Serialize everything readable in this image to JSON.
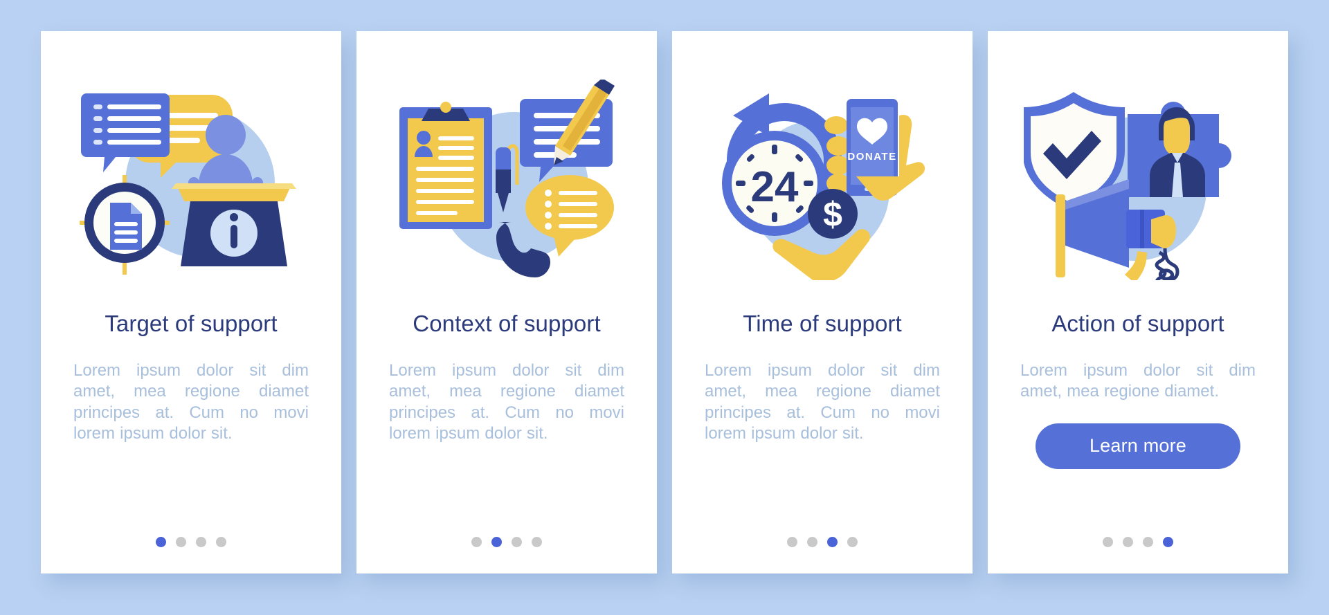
{
  "theme": {
    "background": "#b9d1f2",
    "card_background": "#ffffff",
    "title_color": "#2b3a7a",
    "body_color": "#a8bfdc",
    "accent_blue": "#5570d6",
    "dot_active": "#4a63d8",
    "dot_inactive": "#c9c9c9",
    "accent_yellow": "#f2c94c",
    "accent_navy": "#2b3a7a",
    "blob_blue": "#b6cfef"
  },
  "cards": [
    {
      "illustration_name": "target-of-support-illustration",
      "illustration_icons": [
        "speech-bubble-list-icon",
        "yellow-speech-bubble-icon",
        "crosshair-target-icon",
        "document-icon",
        "speaker-podium-icon",
        "info-circle-icon"
      ],
      "title": "Target of support",
      "body": "Lorem ipsum dolor sit dim amet, mea regione diamet principes at. Cum no movi lorem ipsum dolor sit.",
      "button": null,
      "dots": {
        "count": 4,
        "active_index": 0
      }
    },
    {
      "illustration_name": "context-of-support-illustration",
      "illustration_icons": [
        "clipboard-profile-icon",
        "pen-icon",
        "speech-bubble-lines-icon",
        "pencil-icon",
        "yellow-bullet-bubble-icon",
        "phone-handset-icon"
      ],
      "title": "Context of support",
      "body": "Lorem ipsum dolor sit dim amet, mea regione diamet principes at. Cum no movi lorem ipsum dolor sit.",
      "button": null,
      "dots": {
        "count": 4,
        "active_index": 1
      }
    },
    {
      "illustration_name": "time-of-support-illustration",
      "illustration_icons": [
        "clock-24-icon",
        "refresh-arrow-icon",
        "donate-phone-icon",
        "heart-icon",
        "dollar-coin-icon",
        "open-hand-icon"
      ],
      "illustration_labels": {
        "clock": "24",
        "phone_button": "DONATE"
      },
      "title": "Time of support",
      "body": "Lorem ipsum dolor sit dim amet, mea regione diamet principes at. Cum no movi lorem ipsum dolor sit.",
      "button": null,
      "dots": {
        "count": 4,
        "active_index": 2
      }
    },
    {
      "illustration_name": "action-of-support-illustration",
      "illustration_icons": [
        "shield-check-icon",
        "puzzle-person-icon",
        "megaphone-icon"
      ],
      "title": "Action of support",
      "body": "Lorem ipsum dolor sit dim amet, mea regione diamet.",
      "button": "Learn more",
      "dots": {
        "count": 4,
        "active_index": 3
      }
    }
  ]
}
